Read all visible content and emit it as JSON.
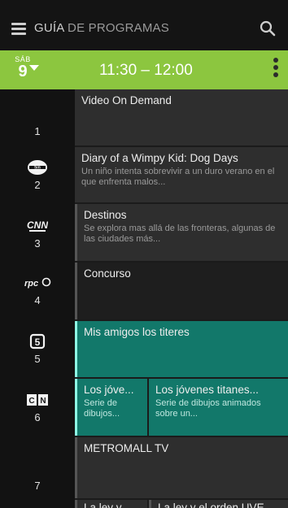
{
  "header": {
    "title_bold": "GUÍA",
    "title_rest": "DE PROGRAMAS"
  },
  "timebar": {
    "day_name": "SÁB",
    "day_number": "9",
    "time_range": "11:30 – 12:00",
    "accent_color": "#8cc63f"
  },
  "channels": [
    {
      "number": "1",
      "logo": ""
    },
    {
      "number": "2",
      "logo": "tvn-logo"
    },
    {
      "number": "3",
      "logo": "cnn-logo"
    },
    {
      "number": "4",
      "logo": "rpc-logo"
    },
    {
      "number": "5",
      "logo": "channel-5-logo"
    },
    {
      "number": "6",
      "logo": "cartoon-network-logo"
    },
    {
      "number": "7",
      "logo": ""
    }
  ],
  "programs": {
    "p1": {
      "title": "Video On Demand",
      "desc": ""
    },
    "p2": {
      "title": "Diary of a Wimpy Kid: Dog Days",
      "desc": "Un niño intenta sobrevivir a un duro verano en el que enfrenta malos..."
    },
    "p3": {
      "title": "Destinos",
      "desc": "Se explora mas allá de las fronteras, algunas de las ciudades más..."
    },
    "p4": {
      "title": "Concurso",
      "desc": ""
    },
    "p5": {
      "title": "Mis amigos los titeres",
      "desc": ""
    },
    "p6a": {
      "title": "Los jóve...",
      "desc": "Serie de dibujos..."
    },
    "p6b": {
      "title": "Los jóvenes titanes...",
      "desc": "Serie de dibujos animados sobre un..."
    },
    "p7": {
      "title": "METROMALL TV",
      "desc": ""
    },
    "p8a": {
      "title": "La ley y...",
      "desc": ""
    },
    "p8b": {
      "title": "La ley y el orden UVE",
      "desc": ""
    }
  },
  "colors": {
    "highlight": "#12786a",
    "now_marker": "#8df5e4"
  }
}
